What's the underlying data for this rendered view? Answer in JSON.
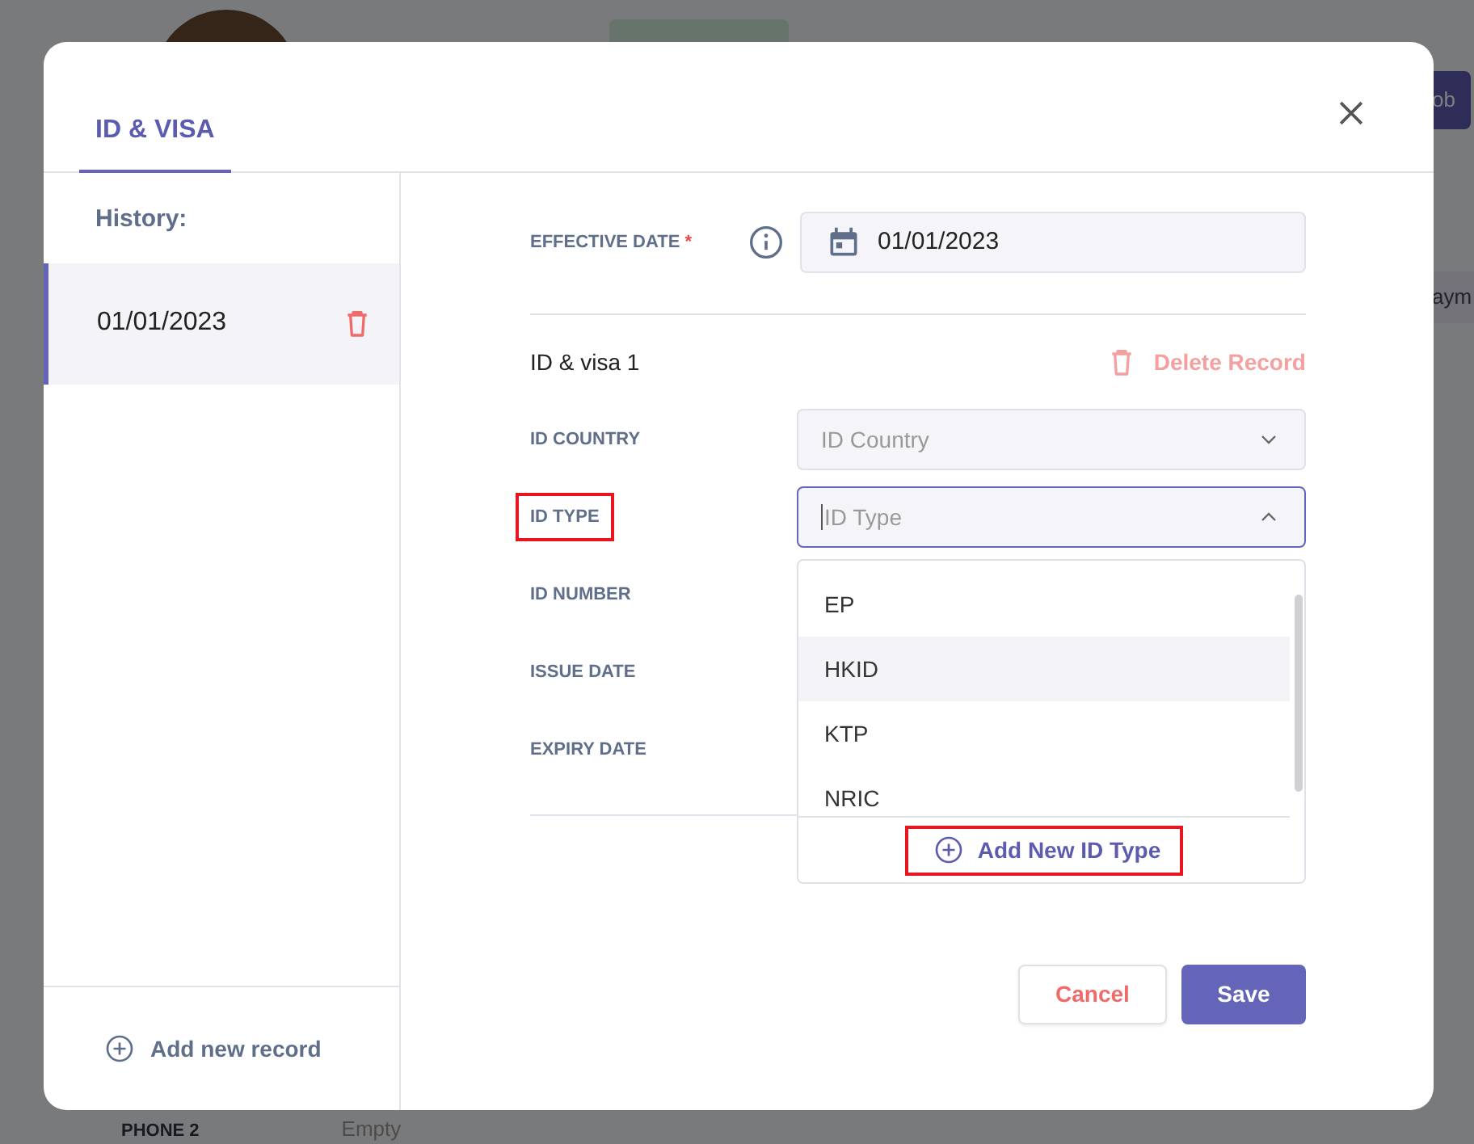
{
  "background": {
    "button_fragment": "ob",
    "tab_fragment": "aym",
    "fields": [
      {
        "label": "PHONE 2",
        "value": "Empty"
      }
    ]
  },
  "modal": {
    "tabs": [
      {
        "label": "ID & VISA",
        "selected": true
      }
    ],
    "history": {
      "title": "History:",
      "records": [
        {
          "date": "01/01/2023",
          "selected": true
        }
      ],
      "add_label": "Add new record"
    },
    "effective_date": {
      "label": "EFFECTIVE DATE",
      "required_mark": "*",
      "value": "01/01/2023"
    },
    "record": {
      "title": "ID & visa 1",
      "delete_label": "Delete Record",
      "delete_disabled": true,
      "fields": [
        {
          "kind": "select",
          "label": "ID COUNTRY",
          "placeholder": "ID Country",
          "open": false,
          "highlighted": false
        },
        {
          "kind": "select",
          "label": "ID TYPE",
          "placeholder": "ID Type",
          "open": true,
          "highlighted": true,
          "options": [
            {
              "label": "EP",
              "hovered": false
            },
            {
              "label": "HKID",
              "hovered": true
            },
            {
              "label": "KTP",
              "hovered": false
            },
            {
              "label": "NRIC",
              "hovered": false
            }
          ],
          "add_option": {
            "label": "Add New ID Type",
            "highlighted": true
          }
        },
        {
          "kind": "covered",
          "label": "ID NUMBER",
          "highlighted": false
        },
        {
          "kind": "covered",
          "label": "ISSUE DATE",
          "highlighted": false
        },
        {
          "kind": "covered",
          "label": "EXPIRY DATE",
          "highlighted": false
        }
      ]
    },
    "buttons": [
      {
        "label": "Cancel",
        "kind": "secondary"
      },
      {
        "label": "Save",
        "kind": "primary"
      }
    ]
  }
}
